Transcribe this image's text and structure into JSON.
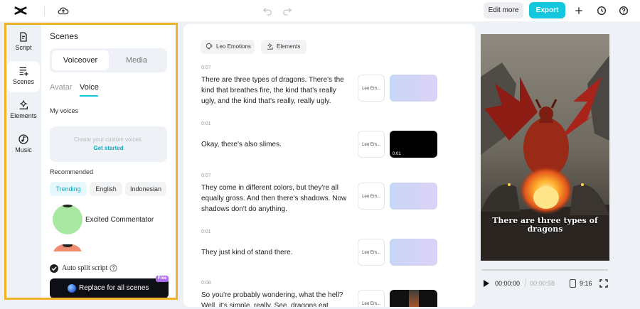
{
  "header": {
    "edit_more_label": "Edit more",
    "export_label": "Export",
    "icons": [
      "capcut-logo-icon",
      "cloud-sync-icon",
      "undo-icon",
      "redo-icon",
      "plus-icon",
      "history-icon",
      "help-icon"
    ],
    "export_color": "#14c7de"
  },
  "nav": {
    "items": [
      {
        "label": "Script",
        "icon": "script-icon",
        "active": false
      },
      {
        "label": "Scenes",
        "icon": "scenes-icon",
        "active": true
      },
      {
        "label": "Elements",
        "icon": "elements-icon",
        "active": false
      },
      {
        "label": "Music",
        "icon": "music-icon",
        "active": false
      }
    ]
  },
  "panel": {
    "title": "Scenes",
    "segments": [
      "Voiceover",
      "Media"
    ],
    "active_segment": "Voiceover",
    "subtabs": [
      "Avatar",
      "Voice"
    ],
    "active_subtab": "Voice",
    "my_voices_label": "My voices",
    "custom_prompt": "Create your custom voices.",
    "get_started_label": "Get started",
    "recommended_label": "Recommended",
    "chips": [
      "Trending",
      "English",
      "Indonesian"
    ],
    "active_chip": "Trending",
    "voices": [
      {
        "name": "Excited Commentator",
        "color": "#a9e8a2"
      },
      {
        "name": "",
        "color": "#f08c72"
      }
    ],
    "auto_split_label": "Auto split script",
    "auto_split_checked": true,
    "replace_label": "Replace for all scenes",
    "free_badge": "Free",
    "highlight_color": "#f2b227"
  },
  "script": {
    "tags": [
      "Leo Emotions",
      "Elements"
    ],
    "scenes": [
      {
        "time": "0:07",
        "text": "There are three types of dragons. There's the kind that breathes fire, the kind that's really ugly, and the kind that's really, really ugly.",
        "avatar_label": "Leo Em...",
        "media": "gradient",
        "media_duration": ""
      },
      {
        "time": "0:01",
        "text": "Okay, there's also slimes.",
        "avatar_label": "Leo Em...",
        "media": "black",
        "media_duration": "0:01"
      },
      {
        "time": "0:07",
        "text": "They come in different colors, but they're all equally gross. And then there's shadows. Now shadows don't do anything.",
        "avatar_label": "Leo Em...",
        "media": "gradient",
        "media_duration": ""
      },
      {
        "time": "0:01",
        "text": "They just kind of stand there.",
        "avatar_label": "Leo Em...",
        "media": "gradient",
        "media_duration": ""
      },
      {
        "time": "0:08",
        "text": "So you're probably wondering, what the hell? Well, it's simple, really. See, dragons eat",
        "avatar_label": "Leo Em...",
        "media": "thumbnail",
        "media_duration": ""
      }
    ]
  },
  "preview": {
    "caption": "There are three types of dragons",
    "current_time": "00:00:00",
    "total_time": "00:00:58",
    "aspect_ratio": "9:16",
    "progress": 0
  }
}
